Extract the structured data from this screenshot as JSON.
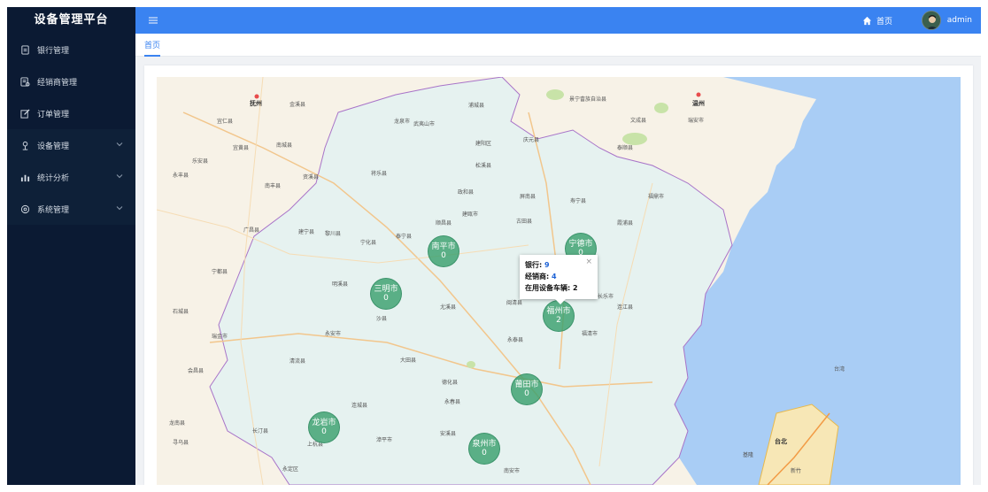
{
  "app": {
    "title": "设备管理平台"
  },
  "sidebar": {
    "items": [
      {
        "label": "银行管理",
        "icon": "document-icon"
      },
      {
        "label": "经销商管理",
        "icon": "document-list-icon"
      },
      {
        "label": "订单管理",
        "icon": "edit-icon"
      },
      {
        "label": "设备管理",
        "icon": "tool-icon",
        "expandable": true
      },
      {
        "label": "统计分析",
        "icon": "chart-icon",
        "expandable": true
      },
      {
        "label": "系统管理",
        "icon": "gear-icon",
        "expandable": true
      }
    ]
  },
  "header": {
    "menu_icon": "hamburger-icon",
    "home_label": "首页",
    "user_name": "admin"
  },
  "tabs": [
    {
      "label": "首页",
      "active": true
    }
  ],
  "map": {
    "labels": {
      "region_places": [
        "抚州",
        "金溪县",
        "宜仁县",
        "宜黄县",
        "南城县",
        "乐安县",
        "永丰县",
        "资溪县",
        "南丰县",
        "黎川县",
        "广昌县",
        "宁都县",
        "石城县",
        "瑞金市",
        "会昌县",
        "寻乌县",
        "龙南县",
        "温州",
        "瑞安市",
        "文成县",
        "泰顺县",
        "景宁畲族自治县",
        "庆元县",
        "龙泉市",
        "松溪县",
        "政和县",
        "寿宁县",
        "福鼎市",
        "霞浦县",
        "连江县",
        "福清市",
        "长乐市",
        "永泰县",
        "德化县",
        "永春县",
        "大田县",
        "尤溪县",
        "沙县",
        "永安市",
        "清流县",
        "明溪县",
        "宁化县",
        "建宁县",
        "泰宁县",
        "将乐县",
        "顺昌县",
        "建阳区",
        "建瓯市",
        "武夷山市",
        "浦城县",
        "屏南县",
        "古田县",
        "闽清县",
        "长汀县",
        "连城县",
        "上杭县",
        "永定区",
        "漳平市",
        "安溪县",
        "南安市",
        "台北",
        "基隆",
        "新竹",
        "台湾"
      ]
    },
    "clusters": [
      {
        "name": "南平市",
        "count": "0"
      },
      {
        "name": "宁德市",
        "count": "0"
      },
      {
        "name": "三明市",
        "count": "0"
      },
      {
        "name": "福州市",
        "count": "2"
      },
      {
        "name": "莆田市",
        "count": "0"
      },
      {
        "name": "龙岩市",
        "count": "0"
      },
      {
        "name": "泉州市",
        "count": "0"
      }
    ],
    "popup": {
      "bank_label": "银行:",
      "bank_value": "9",
      "dealer_label": "经销商:",
      "dealer_value": "4",
      "vehicle_label": "在用设备车辆:",
      "vehicle_value": "2",
      "close": "×"
    },
    "colors": {
      "sea": "#a9cdf5",
      "land": "#f7f2e7",
      "province": "#e6f2f0",
      "cluster": "#3aa06e",
      "border": "#a873c8"
    }
  }
}
